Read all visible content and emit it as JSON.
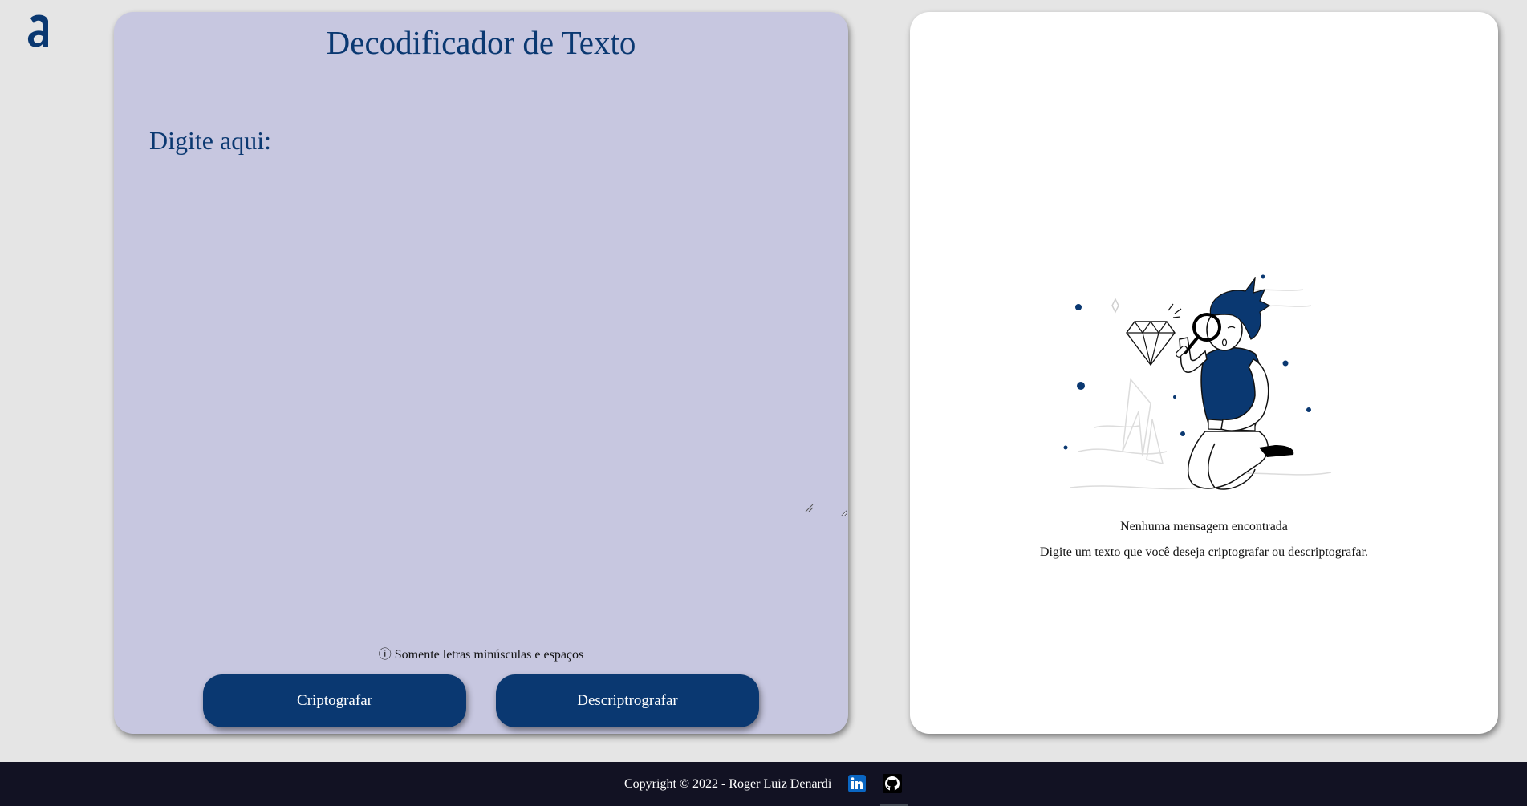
{
  "logo": {
    "icon": "alura-logo-icon",
    "color": "#0a3871"
  },
  "encoder": {
    "title": "Decodificador de Texto",
    "input_placeholder": "Digite aqui:",
    "input_value": "",
    "hint_icon": "info-circle-icon",
    "hint": "ⓘ Somente letras minúsculas e espaços",
    "encrypt_label": "Criptografar",
    "decrypt_label": "Descriptrografar"
  },
  "output": {
    "illustration": "person-with-magnifying-glass-diamond-illustration",
    "empty_title": "Nenhuma mensagem encontrada",
    "empty_desc": "Digite um texto que você deseja criptografar ou descriptografar."
  },
  "footer": {
    "copyright": "Copyright © 2022 - Roger Luiz Denardi",
    "linkedin_icon": "linkedin-icon",
    "github_icon": "github-icon"
  },
  "colors": {
    "accent": "#0a3871",
    "left_panel_bg": "#c7c7e0",
    "page_bg": "#e5e5e5",
    "footer_bg": "#121223"
  }
}
